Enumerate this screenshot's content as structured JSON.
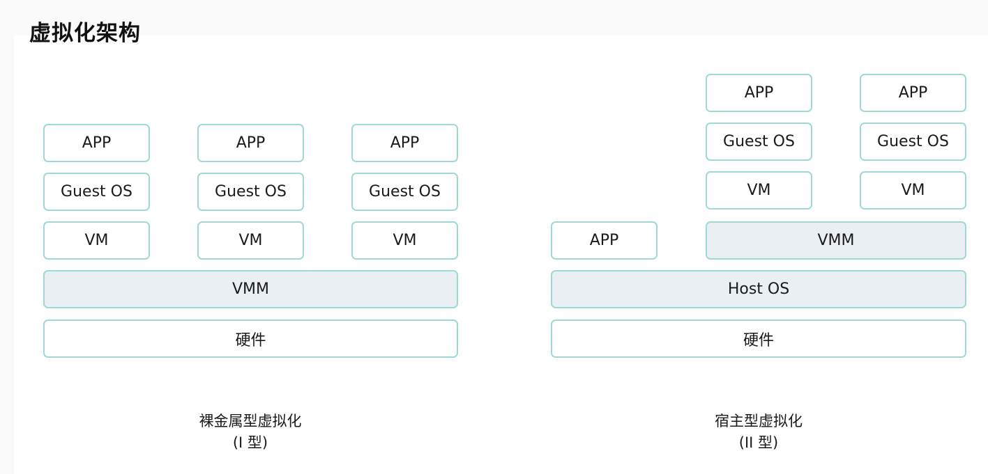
{
  "title": "虚拟化架构",
  "type1": {
    "vms": [
      {
        "app": "APP",
        "guest_os": "Guest OS",
        "vm": "VM"
      },
      {
        "app": "APP",
        "guest_os": "Guest OS",
        "vm": "VM"
      },
      {
        "app": "APP",
        "guest_os": "Guest OS",
        "vm": "VM"
      }
    ],
    "vmm": "VMM",
    "hardware": "硬件",
    "caption_line1": "裸金属型虚拟化",
    "caption_line2": "(I 型)"
  },
  "type2": {
    "vms": [
      {
        "app": "APP",
        "guest_os": "Guest OS",
        "vm": "VM"
      },
      {
        "app": "APP",
        "guest_os": "Guest OS",
        "vm": "VM"
      }
    ],
    "host_app": "APP",
    "vmm": "VMM",
    "host_os": "Host OS",
    "hardware": "硬件",
    "caption_line1": "宿主型虚拟化",
    "caption_line2": "(II 型)"
  },
  "colors": {
    "border": "#9fd9d5",
    "shaded_fill": "#e9eff2",
    "background": "#ffffff"
  }
}
